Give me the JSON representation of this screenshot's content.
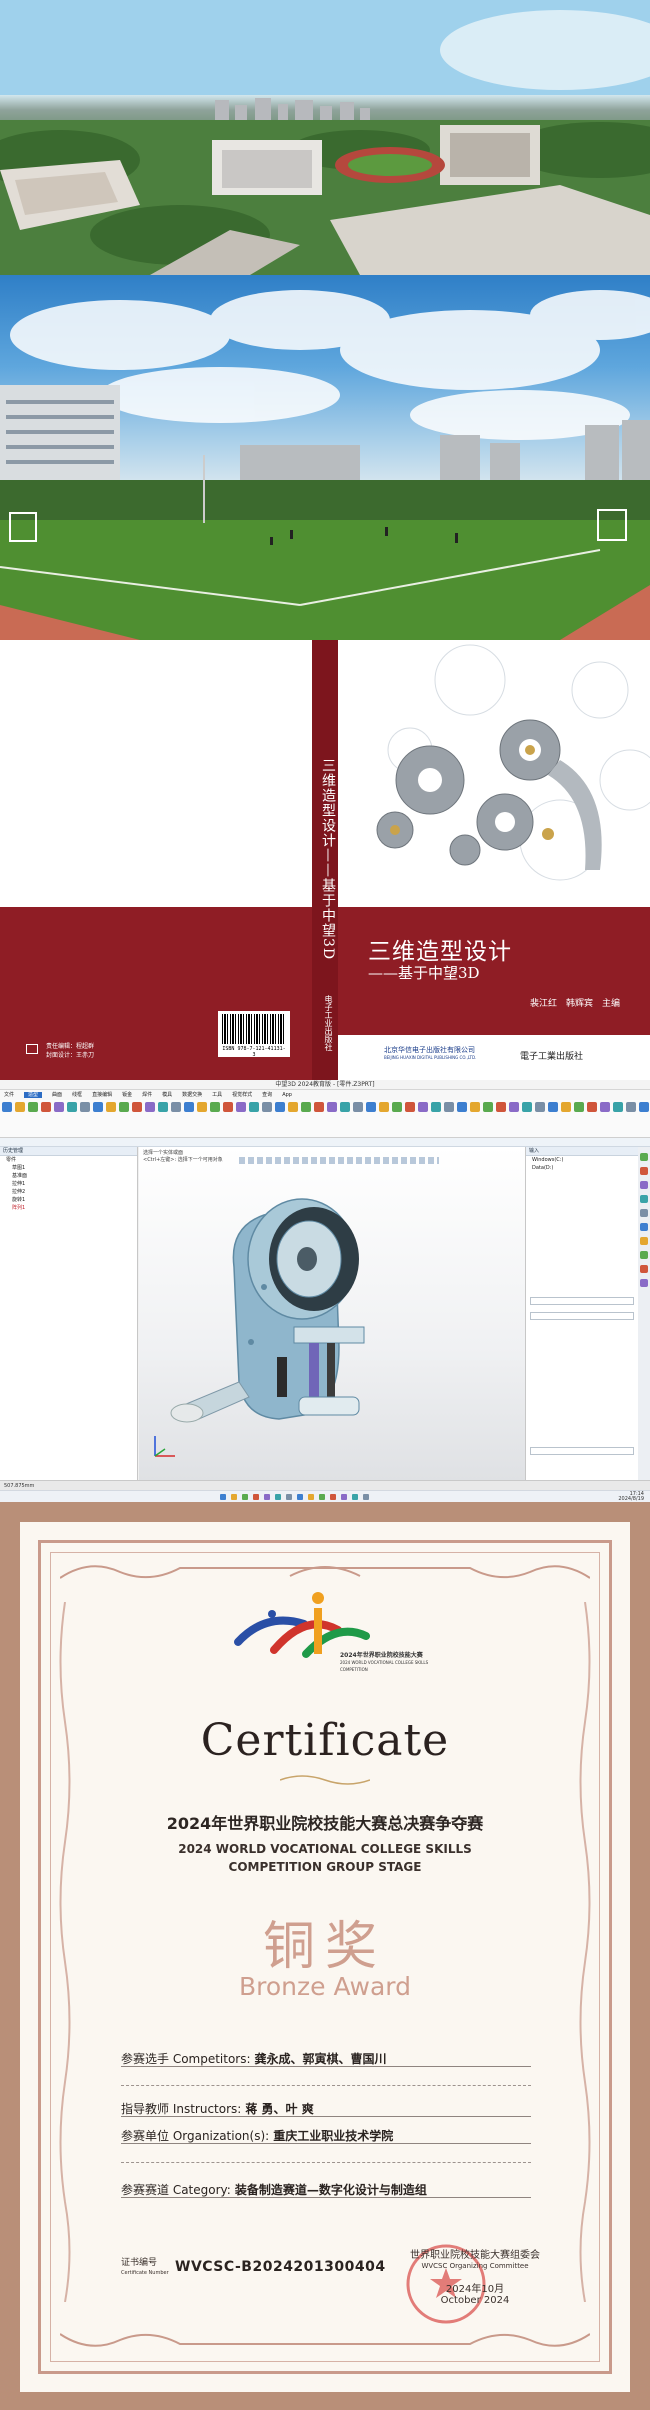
{
  "book": {
    "spine_title": "三维造型设计——基于中望3D",
    "spine_publisher": "电子工业出版社",
    "title": "三维造型设计",
    "subtitle": "——基于中望3D",
    "authors": "裴江红　韩辉宾　主编",
    "isbn": "ISBN 978-7-121-41131-3",
    "back_editor_1": "责任编辑：程超群",
    "back_editor_2": "封面设计：王赤刀",
    "publisher_1": "北京华信电子出版社有限公司",
    "publisher_1_en": "BEIJING HUAXIN DIGITAL PUBLISHING CO.,LTD.",
    "publisher_2": "電子工業出版社"
  },
  "cad": {
    "window_title": "中望3D 2024教育版 - [零件.Z3PRT]",
    "menu": [
      "文件",
      "造型",
      "曲面",
      "线框",
      "直接编辑",
      "钣金",
      "焊件",
      "模具",
      "数据交换",
      "工具",
      "视觉样式",
      "查询",
      "App"
    ],
    "active_menu": "造型",
    "tree_header": "历史管理",
    "tree": [
      "零件",
      "草图1",
      "基准面",
      "拉伸1",
      "拉伸2",
      "旋转1",
      "阵列1"
    ],
    "view_hint_1": "选择一个实体或面",
    "view_hint_2": "<Ctrl+左键>: 选择下一个可用对象",
    "right_header": "输入",
    "right_items": [
      "Windows(C:)",
      "Data(D:)"
    ],
    "status": "507.875mm",
    "time": "17:14",
    "date": "2024/8/19",
    "colors": {
      "accent": "#2b6cc4",
      "part": "#8fb6cc"
    }
  },
  "certificate": {
    "logo_text_cn": "2024年世界职业院校技能大赛",
    "logo_text_en": "2024 WORLD VOCATIONAL COLLEGE SKILLS COMPETITION",
    "title": "Certificate",
    "event_cn": "2024年世界职业院校技能大赛总决赛争夺赛",
    "event_en_1": "2024 WORLD VOCATIONAL COLLEGE SKILLS",
    "event_en_2": "COMPETITION GROUP STAGE",
    "award_cn": "铜奖",
    "award_en": "Bronze Award",
    "competitors_label": "参赛选手 Competitors:",
    "competitors": "龚永成、郭寅棋、曹国川",
    "instructors_label": "指导教师 Instructors:",
    "instructors": "蒋 勇、叶 爽",
    "organization_label": "参赛单位 Organization(s):",
    "organization": "重庆工业职业技术学院",
    "category_label": "参赛赛道 Category:",
    "category": "装备制造赛道—数字化设计与制造组",
    "number_label": "证书编号",
    "number_label_en": "Certificate Number",
    "number": "WVCSC-B2024201300404",
    "org_cn": "世界职业院校技能大赛组委会",
    "org_en": "WVCSC Organizing Committee",
    "date_cn": "2024年10月",
    "date_en": "October 2024",
    "colors": {
      "frame": "#c99a8b",
      "award": "#cf9f8f",
      "seal": "#d9534f"
    }
  }
}
